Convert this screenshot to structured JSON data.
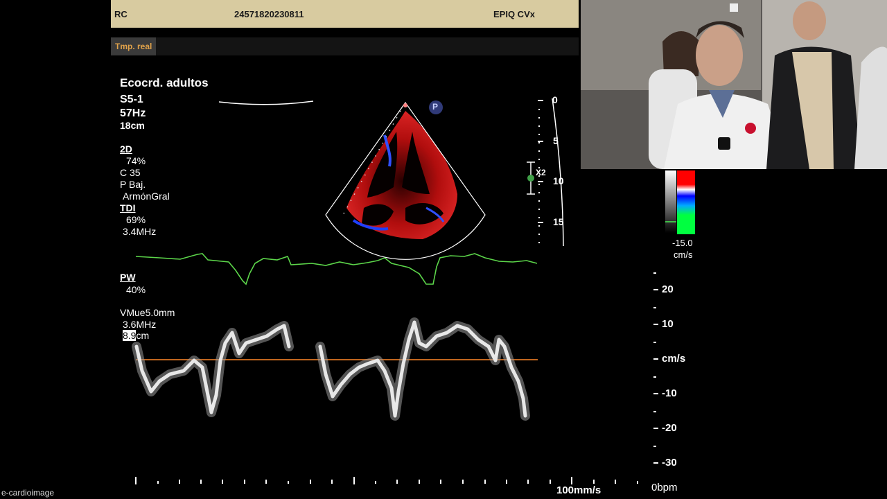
{
  "header": {
    "left": "RC",
    "id": "24571820230811",
    "device": "EPIQ CVx"
  },
  "tab": {
    "label": "Tmp. real"
  },
  "params": {
    "preset": "Ecocrd. adultos",
    "probe": "S5-1",
    "frame_rate": "57Hz",
    "depth": "18cm",
    "mode_2d": "2D",
    "gain_2d": "74%",
    "compression": "C 35",
    "power": "P Baj.",
    "harmonic": "ArmónGral",
    "mode_tdi": "TDI",
    "gain_tdi": "69%",
    "freq_tdi": "3.4MHz",
    "mode_pw": "PW",
    "gain_pw": "40%",
    "sample_volume": "VMue5.0mm",
    "freq_pw": "3.6MHz",
    "depth_sv_highlight": "8.9",
    "depth_sv_unit": "cm"
  },
  "marker_label": "P",
  "depth_scale": {
    "ticks": [
      "0",
      "5",
      "10",
      "15"
    ],
    "zoom_label": "X2"
  },
  "colorbar": {
    "value": "-15.0",
    "unit": "cm/s",
    "colors": [
      "#ff0000",
      "#0000ff",
      "#00ff00"
    ]
  },
  "doppler_scale": {
    "ticks": [
      "20",
      "10",
      "cm/s",
      "-10",
      "-20",
      "-30"
    ]
  },
  "sweep_speed": "100mm/s",
  "heart_rate": "0bpm",
  "watermark": "e-cardioimage",
  "colors": {
    "header_bg": "#d8cba0",
    "tab_text": "#e0a24a",
    "ecg": "#5cd64a",
    "baseline": "#c0651e"
  }
}
